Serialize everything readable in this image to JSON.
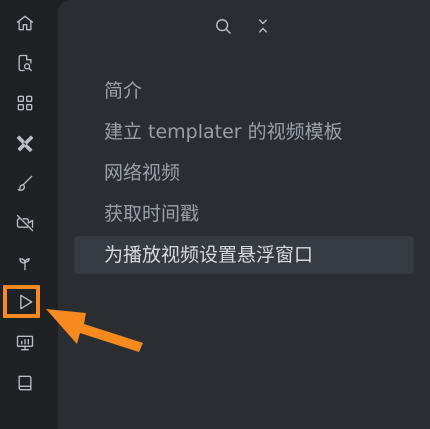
{
  "ribbon": {
    "icons": [
      {
        "name": "home-icon"
      },
      {
        "name": "file-search-icon"
      },
      {
        "name": "grid-icon"
      },
      {
        "name": "tools-icon"
      },
      {
        "name": "brush-icon"
      },
      {
        "name": "video-off-icon"
      },
      {
        "name": "sprout-icon"
      },
      {
        "name": "play-icon"
      },
      {
        "name": "presentation-icon"
      },
      {
        "name": "book-icon"
      }
    ],
    "highlight_color": "#f68a1f"
  },
  "toolbar": {
    "search_icon": "search-icon",
    "collapse_icon": "collapse-icon"
  },
  "outline": {
    "items": [
      {
        "label": "简介"
      },
      {
        "label": "建立 templater 的视频模板"
      },
      {
        "label": "网络视频"
      },
      {
        "label": "获取时间戳"
      },
      {
        "label": "为播放视频设置悬浮窗口"
      }
    ],
    "active_index": 4
  },
  "annotation": {
    "color": "#f68a1f"
  }
}
